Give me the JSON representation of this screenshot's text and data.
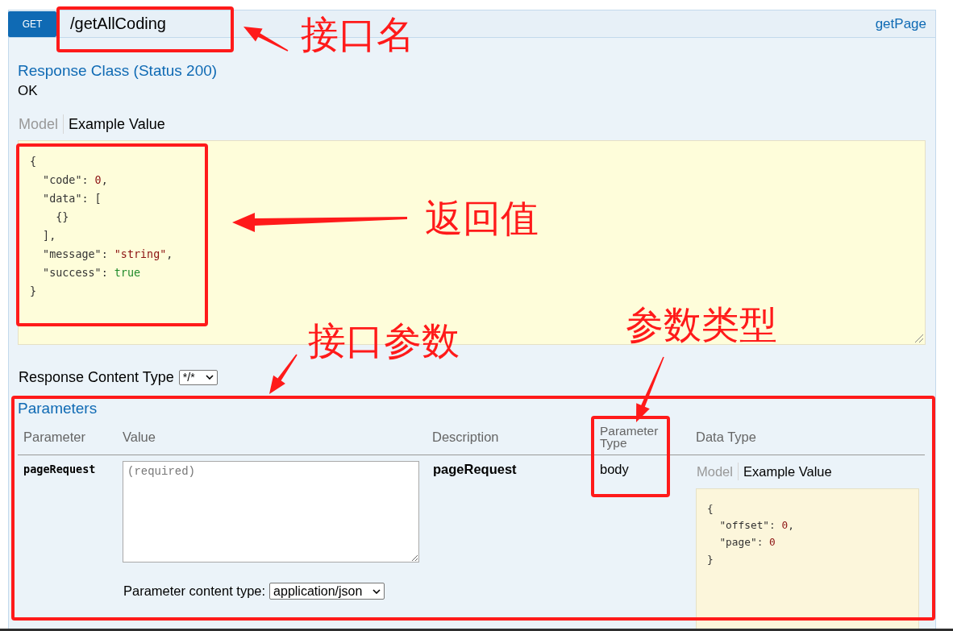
{
  "operation": {
    "method": "GET",
    "path": "/getAllCoding",
    "nickname": "getPage",
    "response_class": {
      "title": "Response Class (Status 200)",
      "description": "OK",
      "tabs": [
        {
          "label": "Model",
          "selected": false
        },
        {
          "label": "Example Value",
          "selected": true
        }
      ],
      "example": [
        {
          "tokens": [
            {
              "kind": "punct",
              "text": "{"
            }
          ],
          "children": [
            {
              "tokens": [
                {
                  "kind": "key",
                  "text": "\"code\""
                },
                {
                  "kind": "punct",
                  "text": ":"
                },
                {
                  "kind": "number",
                  "text": "0"
                },
                {
                  "kind": "punct",
                  "text": ","
                }
              ]
            },
            {
              "tokens": [
                {
                  "kind": "key",
                  "text": "\"data\""
                },
                {
                  "kind": "punct",
                  "text": ":"
                },
                {
                  "kind": "punct",
                  "text": "["
                }
              ],
              "children": [
                {
                  "tokens": [
                    {
                      "kind": "punct",
                      "text": "{}"
                    }
                  ]
                }
              ]
            },
            {
              "tokens": [
                {
                  "kind": "punct",
                  "text": "],"
                }
              ]
            },
            {
              "tokens": [
                {
                  "kind": "key",
                  "text": "\"message\""
                },
                {
                  "kind": "punct",
                  "text": ":"
                },
                {
                  "kind": "string",
                  "text": "\"string\""
                },
                {
                  "kind": "punct",
                  "text": ","
                }
              ]
            },
            {
              "tokens": [
                {
                  "kind": "key",
                  "text": "\"success\""
                },
                {
                  "kind": "punct",
                  "text": ":"
                },
                {
                  "kind": "boolean",
                  "text": "true"
                }
              ]
            }
          ]
        },
        {
          "tokens": [
            {
              "kind": "punct",
              "text": "}"
            }
          ]
        }
      ]
    },
    "response_content_type": {
      "label": "Response Content Type",
      "value": "*/*"
    },
    "parameters": {
      "title": "Parameters",
      "columns": [
        "Parameter",
        "Value",
        "Description",
        "Parameter Type",
        "Data Type"
      ],
      "rows": [
        {
          "parameter": "pageRequest",
          "value": {
            "placeholder": "(required)"
          },
          "content_type": {
            "label": "Parameter content type:",
            "value": "application/json"
          },
          "description": "pageRequest",
          "parameter_type": "body",
          "data_type": {
            "tabs": [
              {
                "label": "Model",
                "selected": false
              },
              {
                "label": "Example Value",
                "selected": true
              }
            ],
            "example": [
              {
                "tokens": [
                  {
                    "kind": "punct",
                    "text": "{"
                  }
                ],
                "children": [
                  {
                    "tokens": [
                      {
                        "kind": "key",
                        "text": "\"offset\""
                      },
                      {
                        "kind": "punct",
                        "text": ":"
                      },
                      {
                        "kind": "number",
                        "text": "0"
                      },
                      {
                        "kind": "punct",
                        "text": ","
                      }
                    ]
                  },
                  {
                    "tokens": [
                      {
                        "kind": "key",
                        "text": "\"page\""
                      },
                      {
                        "kind": "punct",
                        "text": ":"
                      },
                      {
                        "kind": "number",
                        "text": "0"
                      }
                    ]
                  }
                ]
              },
              {
                "tokens": [
                  {
                    "kind": "punct",
                    "text": "}"
                  }
                ]
              }
            ]
          }
        }
      ]
    }
  },
  "annotations": [
    {
      "text": "接口名"
    },
    {
      "text": "返回值"
    },
    {
      "text": "接口参数"
    },
    {
      "text": "参数类型"
    }
  ]
}
